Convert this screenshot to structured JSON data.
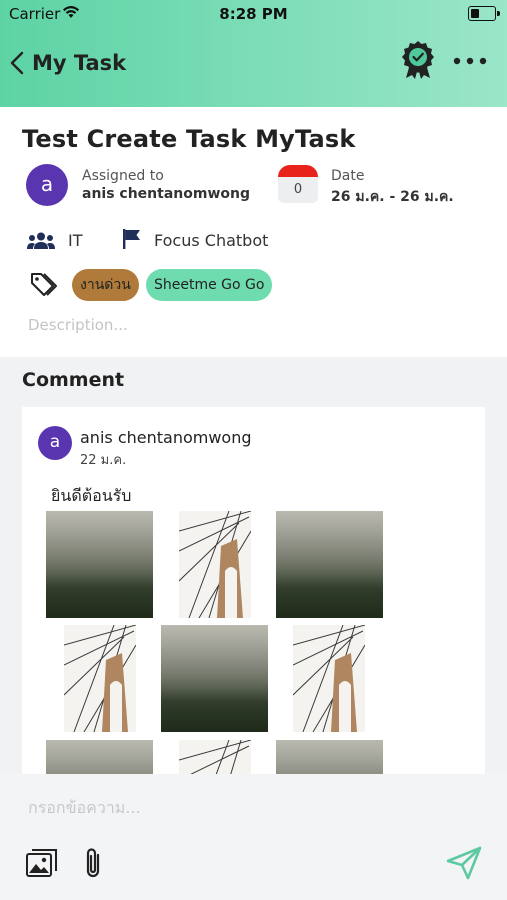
{
  "status_bar": {
    "carrier": "Carrier",
    "time": "8:28 PM"
  },
  "nav": {
    "title": "My Task"
  },
  "task": {
    "title": "Test Create Task MyTask",
    "assignee_initial": "a",
    "assigned_label": "Assigned to",
    "assignee_name": "anis chentanomwong",
    "calendar_badge": "0",
    "date_label": "Date",
    "date_value": "26 ม.ค. - 26 ม.ค.",
    "team": "IT",
    "project": "Focus Chatbot",
    "tags": [
      "งานด่วน",
      "Sheetme Go Go"
    ],
    "tag_colors": [
      "#b07a3a",
      "#6fdcb0"
    ],
    "description_placeholder": "Description..."
  },
  "comments": {
    "heading": "Comment",
    "items": [
      {
        "initial": "a",
        "author": "anis chentanomwong",
        "date": "22 ม.ค.",
        "text": "ยินดีต้อนรับ"
      }
    ]
  },
  "composer": {
    "placeholder": "กรอกข้อความ..."
  },
  "colors": {
    "accent": "#5dd3a4",
    "avatar": "#5a35b0",
    "calendar_red": "#e8231b",
    "send": "#5dc9a0"
  }
}
